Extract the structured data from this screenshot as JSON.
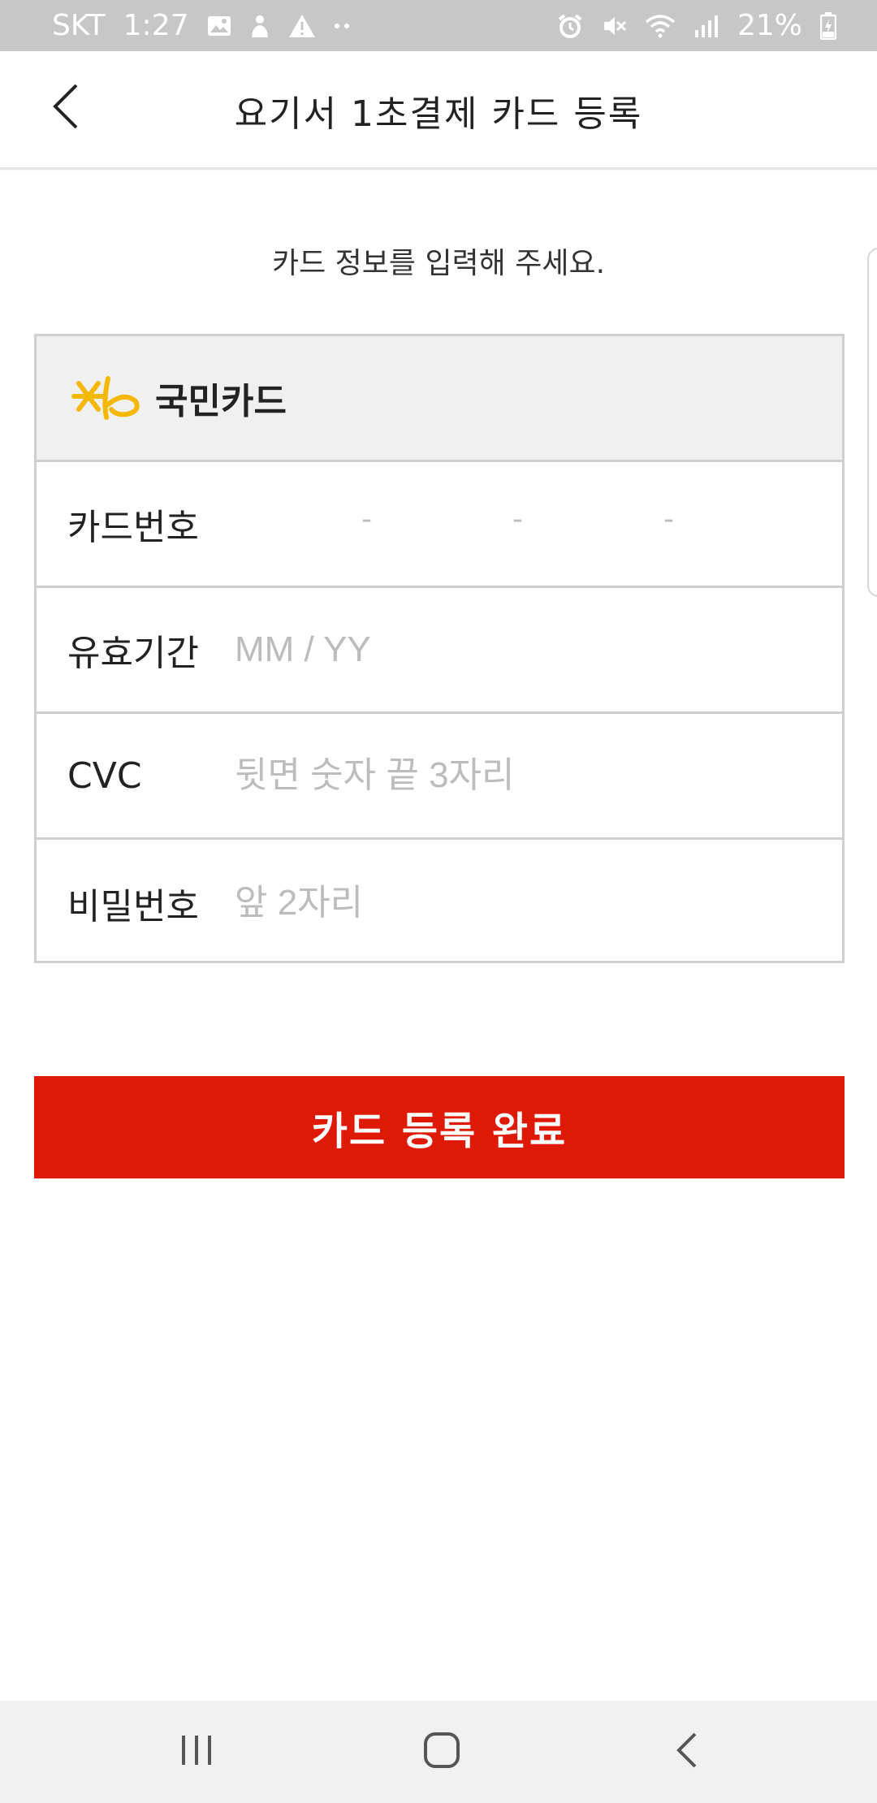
{
  "status_bar": {
    "carrier": "SKT",
    "time": "1:27",
    "battery": "21%",
    "left_icons": [
      "image-icon",
      "person-icon",
      "warning-icon",
      "more-dots-icon"
    ],
    "right_icons": [
      "alarm-icon",
      "mute-icon",
      "wifi-icon",
      "signal-icon",
      "battery-icon"
    ]
  },
  "app_bar": {
    "title": "요기서 1초결제 카드 등록",
    "back_icon": "chevron-left-icon"
  },
  "instruction": "카드 정보를 입력해 주세요.",
  "card_form": {
    "brand": {
      "name": "국민카드",
      "logo": "kb-logo",
      "logo_color": "#f5b800"
    },
    "rows": [
      {
        "label": "카드번호",
        "separators": [
          "-",
          "-",
          "-"
        ]
      },
      {
        "label": "유효기간",
        "placeholder": "MM / YY"
      },
      {
        "label": "CVC",
        "placeholder": "뒷면 숫자 끝 3자리"
      },
      {
        "label": "비밀번호",
        "placeholder": "앞 2자리"
      }
    ]
  },
  "submit_button": {
    "label": "카드 등록 완료",
    "color": "#de1a06"
  },
  "nav_bar": {
    "recent_apps_icon": "recent-apps-icon",
    "home_icon": "home-icon",
    "back_icon": "back-icon"
  }
}
